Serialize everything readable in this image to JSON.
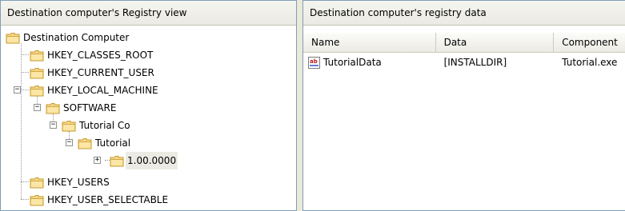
{
  "left_pane": {
    "header": "Destination computer's Registry view",
    "tree": {
      "root": "Destination Computer",
      "hkcr": "HKEY_CLASSES_ROOT",
      "hkcu": "HKEY_CURRENT_USER",
      "hklm": "HKEY_LOCAL_MACHINE",
      "software": "SOFTWARE",
      "tutorial_co": "Tutorial Co",
      "tutorial": "Tutorial",
      "version": "1.00.0000",
      "hku": "HKEY_USERS",
      "hkus": "HKEY_USER_SELECTABLE",
      "expanded_sign": "−",
      "collapsed_sign": "+"
    }
  },
  "right_pane": {
    "header": "Destination computer's registry data",
    "columns": [
      "Name",
      "Data",
      "Component"
    ],
    "rows": [
      {
        "name": "TutorialData",
        "data": "[INSTALLDIR]",
        "component": "Tutorial.exe",
        "icon": "ab-string-value-icon"
      }
    ]
  },
  "colors": {
    "folder_fill": "#f7d98d",
    "folder_stroke": "#c79a2e",
    "selection": "#ecebe3"
  }
}
